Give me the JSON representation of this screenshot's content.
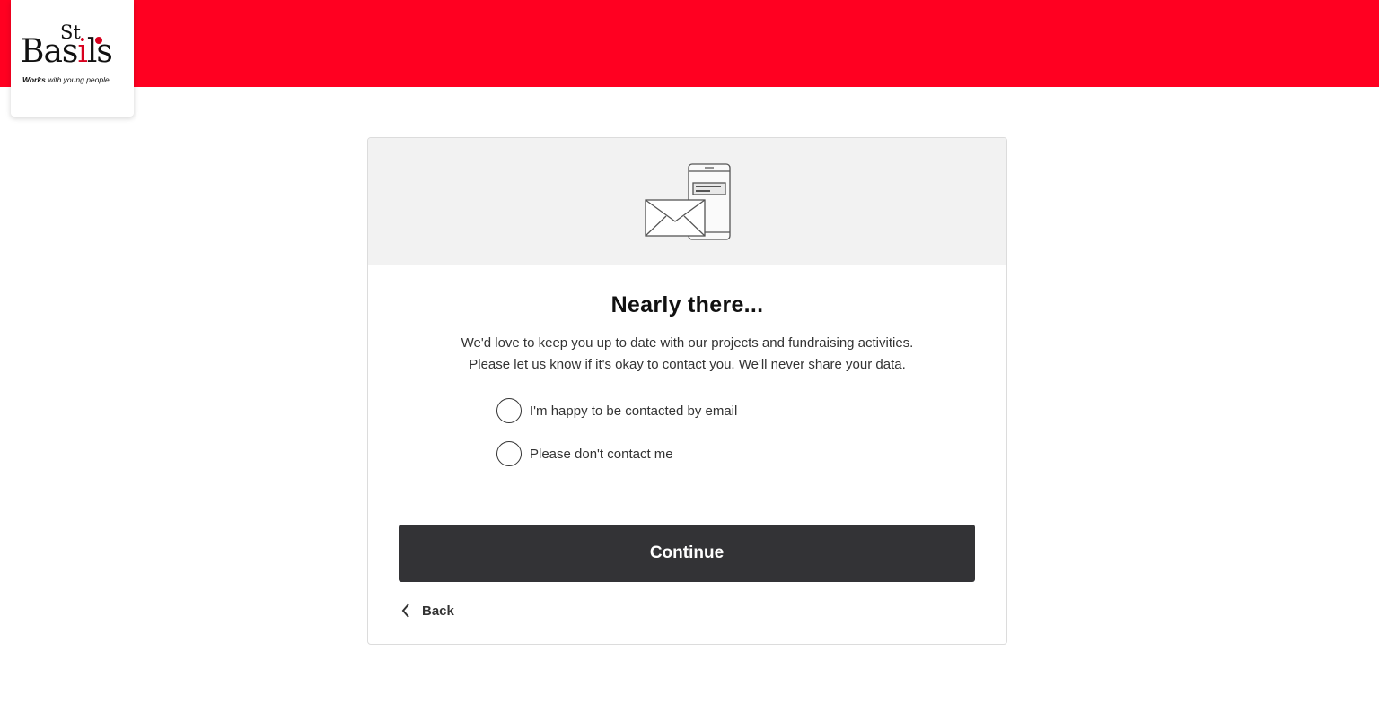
{
  "brand": {
    "logo_st": "St",
    "logo_basils_pre": "Bas",
    "logo_basils_i": "i",
    "logo_basils_post": "ls",
    "tagline_bold": "Works",
    "tagline_rest": " with young people",
    "accent_color": "#ff0021"
  },
  "card": {
    "hero_icon": "envelope-and-phone-icon",
    "title": "Nearly there...",
    "description_line1": "We'd love to keep you up to date with our projects and fundraising activities.",
    "description_line2": "Please let us know if it's okay to contact you. We'll never share your data.",
    "options": [
      {
        "label": "I'm happy to be contacted by email",
        "selected": false
      },
      {
        "label": "Please don't contact me",
        "selected": false
      }
    ],
    "continue_label": "Continue",
    "back_label": "Back"
  }
}
